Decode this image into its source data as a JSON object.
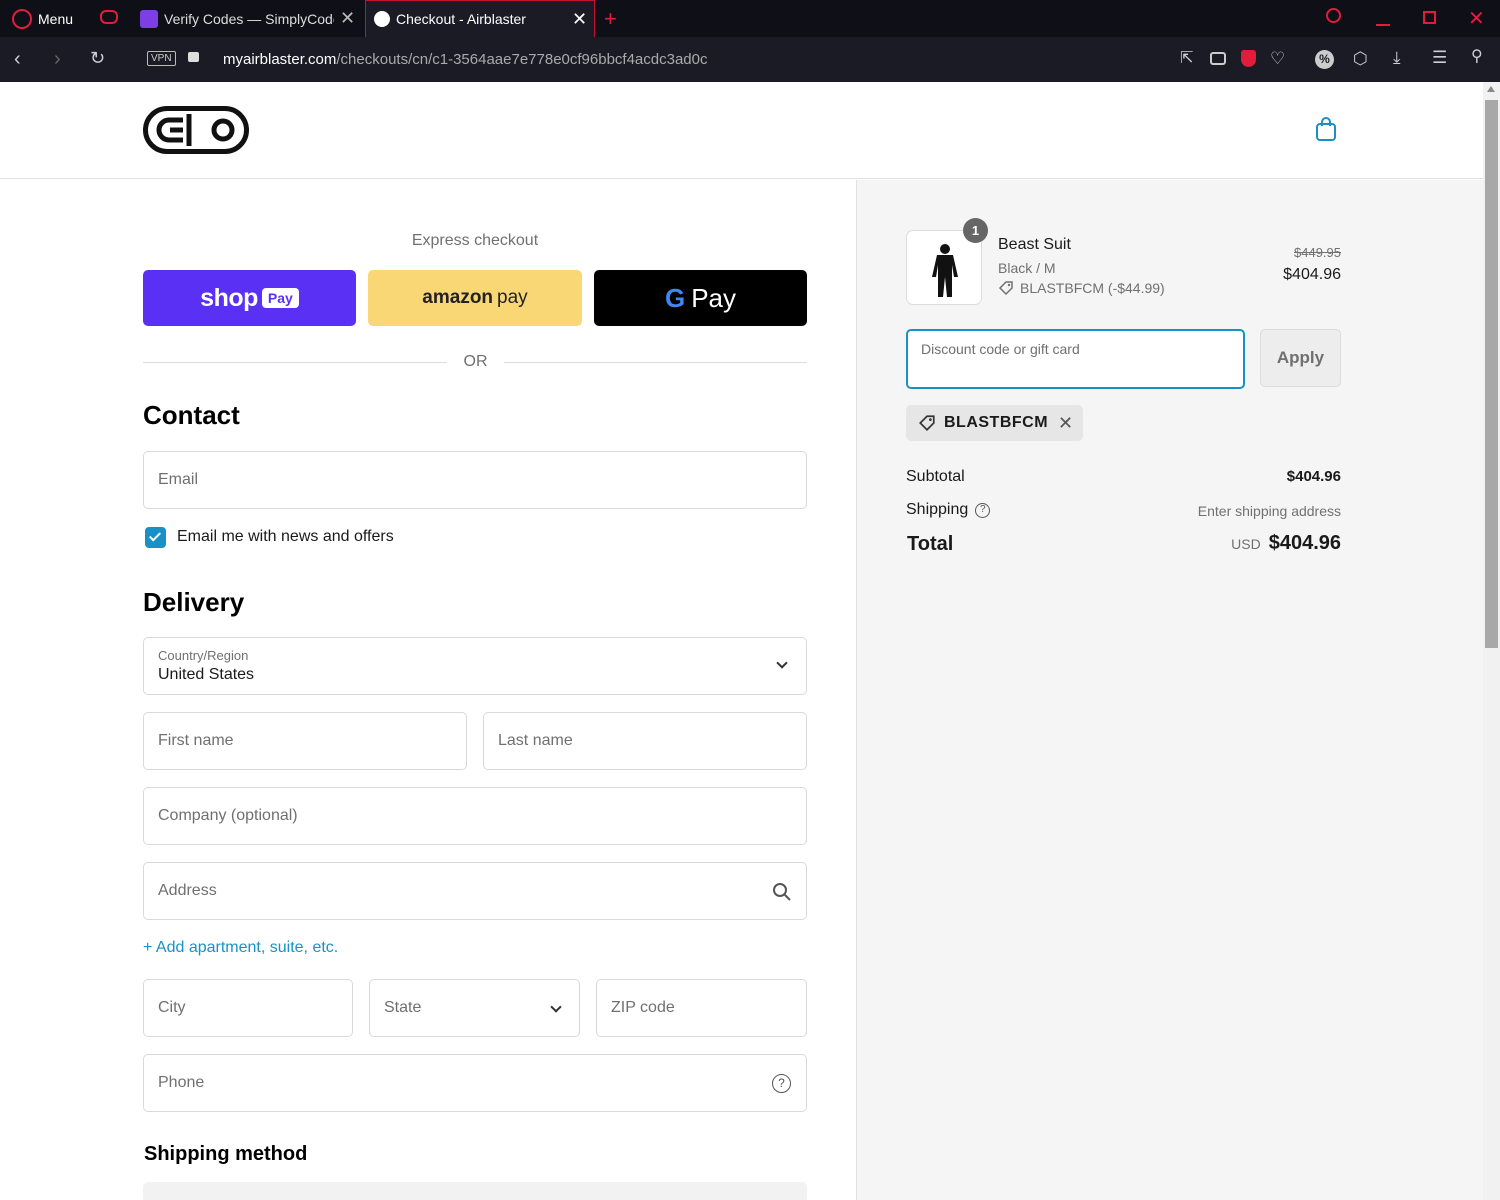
{
  "browser": {
    "menu_label": "Menu",
    "tabs": [
      {
        "title": "Verify Codes — SimplyCodes"
      },
      {
        "title": "Checkout - Airblaster"
      }
    ],
    "vpn_label": "VPN",
    "url_host": "myairblaster.com",
    "url_path": "/checkouts/cn/c1-3564aae7e778e0cf96bbcf4acdc3ad0c"
  },
  "express": {
    "heading": "Express checkout",
    "shop_pay": {
      "word": "shop",
      "badge": "Pay"
    },
    "amazon_pay": {
      "word": "amazon",
      "suffix": "pay"
    },
    "google_pay": {
      "g": "G",
      "word": "Pay"
    },
    "divider": "OR"
  },
  "contact": {
    "heading": "Contact",
    "email_placeholder": "Email",
    "newsletter_label": "Email me with news and offers"
  },
  "delivery": {
    "heading": "Delivery",
    "country_label": "Country/Region",
    "country_value": "United States",
    "first_name": "First name",
    "last_name": "Last name",
    "company": "Company (optional)",
    "address": "Address",
    "add_apartment": "Add apartment, suite, etc.",
    "city": "City",
    "state": "State",
    "zip": "ZIP code",
    "phone": "Phone"
  },
  "shipping_method": {
    "heading": "Shipping method"
  },
  "summary": {
    "item": {
      "quantity": "1",
      "name": "Beast Suit",
      "variant": "Black / M",
      "discount": "BLASTBFCM (-$44.99)",
      "original_price": "$449.95",
      "price": "$404.96"
    },
    "discount_placeholder": "Discount code or gift card",
    "apply_label": "Apply",
    "applied_code": "BLASTBFCM",
    "subtotal_label": "Subtotal",
    "subtotal_value": "$404.96",
    "shipping_label": "Shipping",
    "shipping_value": "Enter shipping address",
    "total_label": "Total",
    "total_currency": "USD",
    "total_value": "$404.96"
  },
  "colors": {
    "shop_pay": "#5a31f4",
    "amazon_pay": "#f9d775",
    "google_pay": "#000000",
    "accent": "#1990c6",
    "browser_red": "#c8102e"
  }
}
